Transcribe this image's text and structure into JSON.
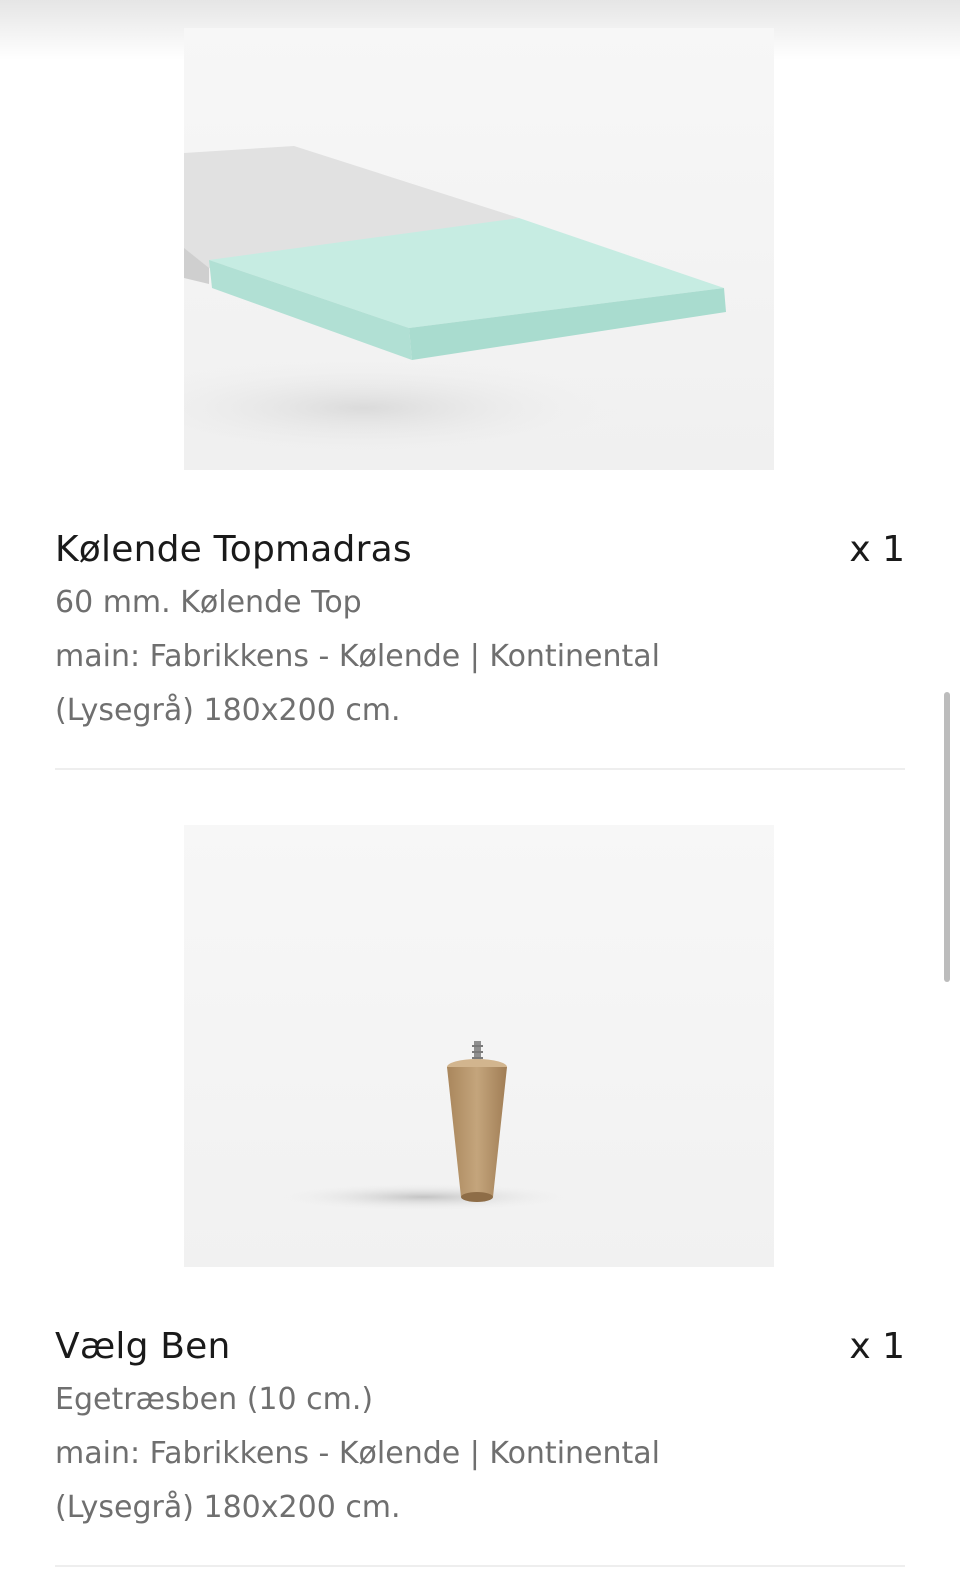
{
  "items": [
    {
      "image_icon": "mattress-topper-image",
      "name": "Kølende Topmadras",
      "quantity": "x 1",
      "details": [
        "60 mm. Kølende Top",
        "main: Fabrikkens - Kølende | Kontinental",
        "(Lysegrå) 180x200 cm."
      ]
    },
    {
      "image_icon": "wooden-leg-image",
      "name": "Vælg Ben",
      "quantity": "x 1",
      "details": [
        "Egetræsben (10 cm.)",
        "main: Fabrikkens - Kølende | Kontinental",
        "(Lysegrå) 180x200 cm."
      ]
    }
  ],
  "colors": {
    "topper_mint": "#bfe8dd",
    "topper_grey": "#dcdcdc",
    "wood": "#b8956a",
    "text_primary": "#1a1a1a",
    "text_secondary": "#6f6f6f"
  }
}
